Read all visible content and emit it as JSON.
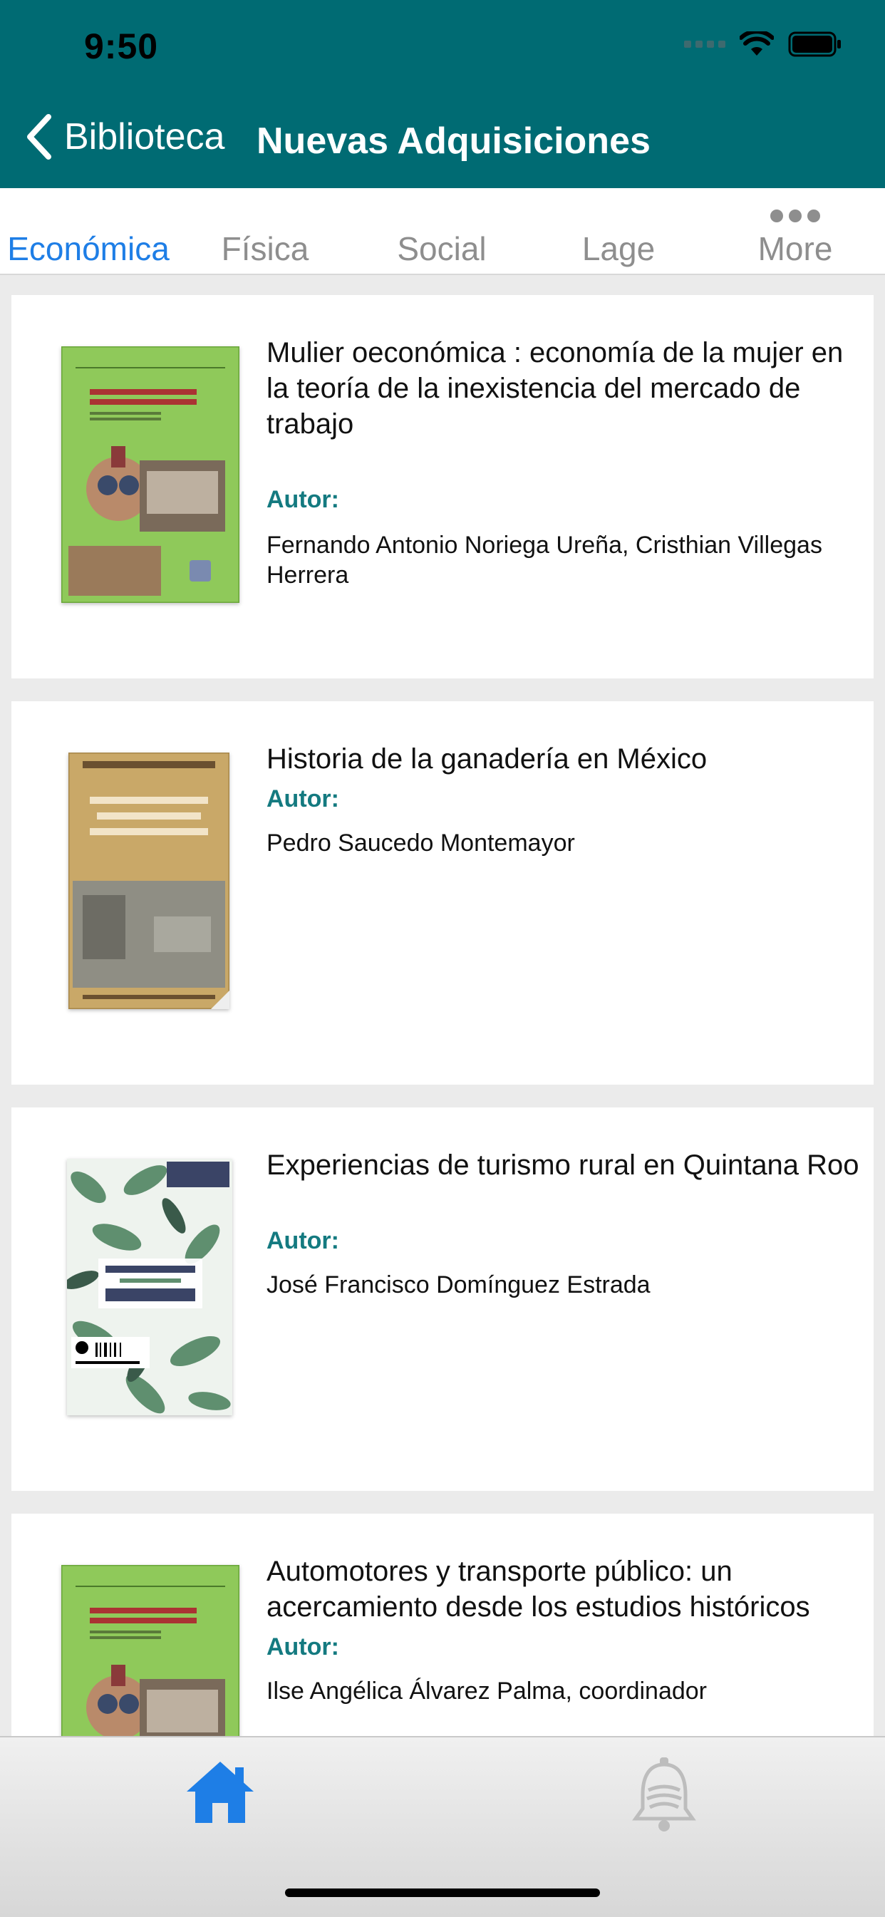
{
  "status_bar": {
    "time": "9:50"
  },
  "nav": {
    "back_label": "Biblioteca",
    "title": "Nuevas Adquisiciones"
  },
  "tabs": [
    {
      "label": "Económica",
      "active": true
    },
    {
      "label": "Física",
      "active": false
    },
    {
      "label": "Social",
      "active": false
    },
    {
      "label": "Lage",
      "active": false
    },
    {
      "label": "More",
      "active": false
    }
  ],
  "books": [
    {
      "title": "Mulier oeconómica : economía de la mujer en la teoría de la inexistencia del mercado de trabajo",
      "author_label": "Autor:",
      "author": "Fernando Antonio Noriega Ureña, Cristhian Villegas Herrera",
      "cover": "green-automotores"
    },
    {
      "title": "Historia de la ganadería en México",
      "author_label": "Autor:",
      "author": "Pedro Saucedo Montemayor",
      "cover": "tan-historia"
    },
    {
      "title": "Experiencias de turismo rural en Quintana Roo",
      "author_label": "Autor:",
      "author": "José Francisco Domínguez Estrada",
      "cover": "leaf-pattern"
    },
    {
      "title": "Automotores y transporte público: un acercamiento desde los estudios históricos",
      "author_label": "Autor:",
      "author": "Ilse Angélica Álvarez Palma, coordinador",
      "cover": "green-automotores"
    }
  ],
  "tabbar": {
    "items": [
      {
        "icon": "home-icon",
        "active": true
      },
      {
        "icon": "bell-icon",
        "active": false
      }
    ]
  },
  "colors": {
    "header": "#006b73",
    "accent": "#1e7ee6",
    "author_label": "#147a80"
  }
}
